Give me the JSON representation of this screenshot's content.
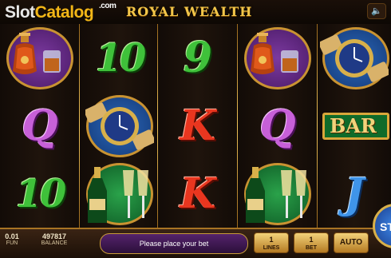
{
  "watermark": {
    "slot": "Slot",
    "catalog": "Catalog",
    "com": ".com"
  },
  "game": {
    "title": "ROYAL WEALTH"
  },
  "controls": {
    "sound_icon": "speaker-icon",
    "spin_label": "ST",
    "fun_value": "0.01",
    "fun_label": "FUN",
    "balance_value": "497817",
    "balance_label": "BALANCE",
    "message": "Please place your bet",
    "lines_value": "1",
    "lines_label": "LINES",
    "bet_value": "1",
    "bet_label": "BET",
    "auto_label": "AUTO"
  },
  "reels": [
    [
      "cognac-icon",
      "Q",
      "10"
    ],
    [
      "10",
      "watch-icon",
      "champagne-icon"
    ],
    [
      "9",
      "K",
      "K"
    ],
    [
      "cognac-icon",
      "Q",
      "champagne-icon"
    ],
    [
      "watch-icon",
      "BAR",
      "J"
    ]
  ],
  "colors": {
    "gold": "#f2c64a",
    "green": "#3fc13a",
    "purple": "#c760d8",
    "red": "#e9361f",
    "blue": "#3f94e9"
  }
}
